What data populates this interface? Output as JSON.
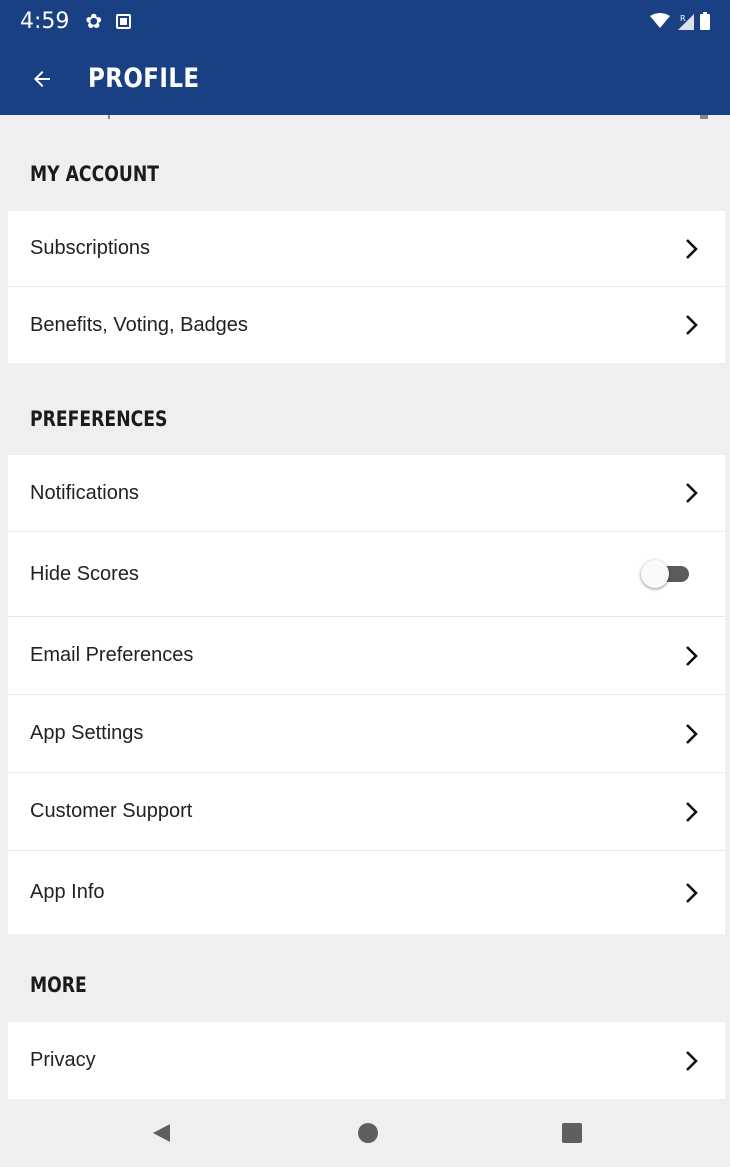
{
  "status_bar": {
    "time": "4:59",
    "icons": [
      "gear-icon",
      "notification-icon",
      "wifi-icon",
      "signal-icon",
      "battery-icon"
    ]
  },
  "header": {
    "title": "PROFILE",
    "back_icon": "arrow-left-icon",
    "background_color": "#1a4084"
  },
  "sections": {
    "my_account": {
      "title": "MY ACCOUNT",
      "items": [
        {
          "label": "Subscriptions",
          "control": "chevron"
        },
        {
          "label": "Benefits, Voting, Badges",
          "control": "chevron"
        }
      ]
    },
    "preferences": {
      "title": "PREFERENCES",
      "items": [
        {
          "label": "Notifications",
          "control": "chevron"
        },
        {
          "label": "Hide Scores",
          "control": "toggle",
          "toggle_on": false
        },
        {
          "label": "Email Preferences",
          "control": "chevron"
        },
        {
          "label": "App Settings",
          "control": "chevron"
        },
        {
          "label": "Customer Support",
          "control": "chevron"
        },
        {
          "label": "App Info",
          "control": "chevron"
        }
      ]
    },
    "more": {
      "title": "MORE",
      "items": [
        {
          "label": "Privacy",
          "control": "chevron"
        }
      ]
    }
  },
  "nav_bar": {
    "buttons": [
      "back-triangle-icon",
      "home-circle-icon",
      "recents-square-icon"
    ]
  }
}
